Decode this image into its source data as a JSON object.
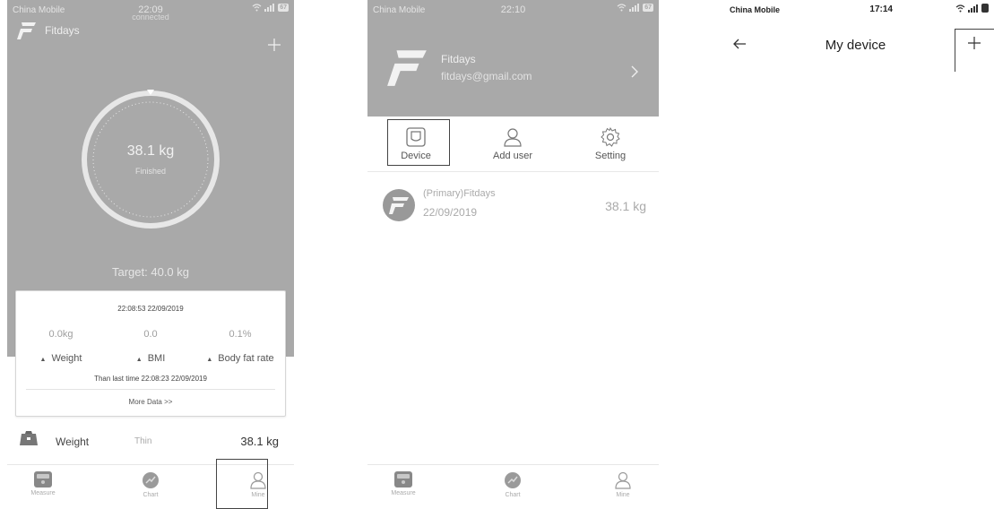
{
  "colors": {
    "hero_gray": "#a9a9a9",
    "highlight": "#444444",
    "muted": "#aaaaaa"
  },
  "screen1": {
    "status": {
      "carrier": "China Mobile",
      "time": "22:09",
      "battery": "67"
    },
    "brand": "Fitdays",
    "connection": "connected",
    "add_icon": "plus-icon",
    "ring": {
      "weight": "38.1 kg",
      "status": "Finished"
    },
    "target": "Target: 40.0 kg",
    "card": {
      "timestamp": "22:08:53 22/09/2019",
      "metrics": [
        {
          "value": "0.0kg",
          "label": "Weight"
        },
        {
          "value": "0.0",
          "label": "BMI"
        },
        {
          "value": "0.1%",
          "label": "Body fat rate"
        }
      ],
      "comparison": "Than last time 22:08:23 22/09/2019",
      "more": "More Data >>"
    },
    "weight_row": {
      "label": "Weight",
      "status": "Thin",
      "value": "38.1 kg"
    },
    "tabs": [
      {
        "label": "Measure",
        "icon": "scale-icon"
      },
      {
        "label": "Chart",
        "icon": "chart-icon"
      },
      {
        "label": "Mine",
        "icon": "person-icon"
      }
    ]
  },
  "screen2": {
    "status": {
      "carrier": "China Mobile",
      "time": "22:10",
      "battery": "67"
    },
    "profile": {
      "name": "Fitdays",
      "email": "fitdays@gmail.com"
    },
    "actions": [
      {
        "label": "Device",
        "icon": "device-icon"
      },
      {
        "label": "Add user",
        "icon": "add-user-icon"
      },
      {
        "label": "Setting",
        "icon": "gear-icon"
      }
    ],
    "device": {
      "name": "(Primary)Fitdays",
      "date": "22/09/2019",
      "weight": "38.1 kg"
    },
    "tabs": [
      {
        "label": "Measure",
        "icon": "scale-icon"
      },
      {
        "label": "Chart",
        "icon": "chart-icon"
      },
      {
        "label": "Mine",
        "icon": "person-icon"
      }
    ]
  },
  "screen3": {
    "status": {
      "carrier": "China Mobile",
      "time": "17:14"
    },
    "title": "My device",
    "back_icon": "back-arrow-icon",
    "add_icon": "plus-icon"
  }
}
